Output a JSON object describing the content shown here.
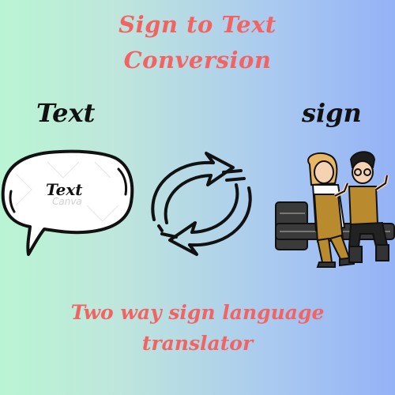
{
  "header": {
    "title_line1": "Sign to Text",
    "title_line2": "Conversion"
  },
  "labels": {
    "left": "Text",
    "right": "sign"
  },
  "bubble": {
    "text": "Text",
    "watermark": "Canva"
  },
  "footer": {
    "line1": "Two way sign language",
    "line2": "translator"
  },
  "icons": {
    "bubble": "speech-bubble-icon",
    "convert": "sync-arrows-icon",
    "people": "signing-children-illustration"
  },
  "colors": {
    "title": "#f26464",
    "text": "#111111",
    "gradient_left": "#b9f5d4",
    "gradient_right": "#94b2f6"
  }
}
